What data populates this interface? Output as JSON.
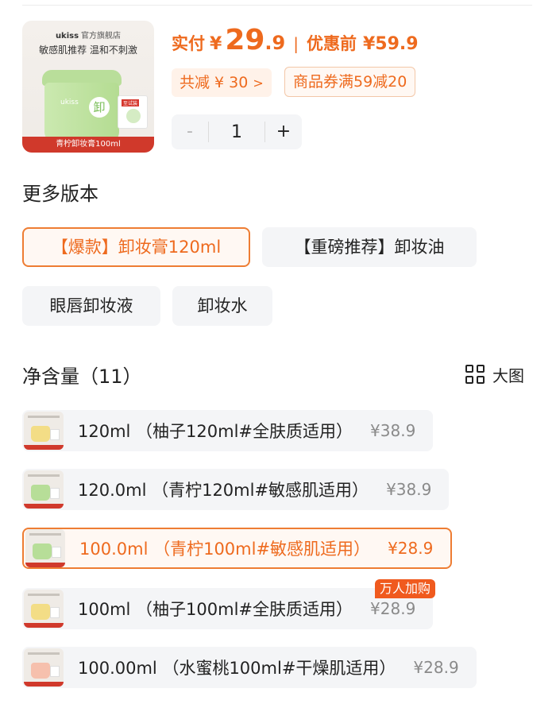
{
  "product": {
    "image": {
      "brand": "ukiss",
      "store": "官方旗舰店",
      "slogan": "敏感肌推荐 温和不刺激",
      "jar_label": "ukiss",
      "jar_char": "卸",
      "sample_tag": "至试装",
      "caption": "青柠卸妆膏100ml"
    },
    "price": {
      "label": "实付",
      "currency": "¥",
      "integer": "29",
      "decimal": ".9",
      "separator": "|",
      "original_label": "优惠前",
      "original": "¥59.9"
    },
    "discount": {
      "total_text": "共减 ¥ 30",
      "coupon_text": "商品券满59减20"
    },
    "quantity": {
      "minus": "-",
      "value": "1",
      "plus": "+"
    }
  },
  "more_versions": {
    "title": "更多版本",
    "options": [
      {
        "label": "【爆款】卸妆膏120ml",
        "selected": true
      },
      {
        "label": "【重磅推荐】卸妆油",
        "selected": false
      },
      {
        "label": "眼唇卸妆液",
        "selected": false
      },
      {
        "label": "卸妆水",
        "selected": false
      }
    ]
  },
  "net_content": {
    "title": "净含量（11）",
    "big_view_label": "大图",
    "items": [
      {
        "label": "120ml （柚子120ml#全肤质适用）",
        "price": "¥38.9",
        "color": "#f3dd86",
        "selected": false
      },
      {
        "label": "120.0ml （青柠120ml#敏感肌适用）",
        "price": "¥38.9",
        "color": "#b7de98",
        "selected": false
      },
      {
        "label": "100.0ml （青柠100ml#敏感肌适用）",
        "price": "¥28.9",
        "color": "#b7de98",
        "selected": true
      },
      {
        "label": "100ml （柚子100ml#全肤质适用）",
        "price": "¥28.9",
        "color": "#f3dd86",
        "selected": false,
        "badge": "万人加购"
      },
      {
        "label": "100.00ml （水蜜桃100ml#干燥肌适用）",
        "price": "¥28.9",
        "color": "#f6c0ad",
        "selected": false
      }
    ]
  },
  "colors": {
    "accent": "#ee6a1e",
    "selected_border": "#ee7d33",
    "option_bg": "#f4f5f7",
    "badge_bg": "#f05a1e"
  }
}
